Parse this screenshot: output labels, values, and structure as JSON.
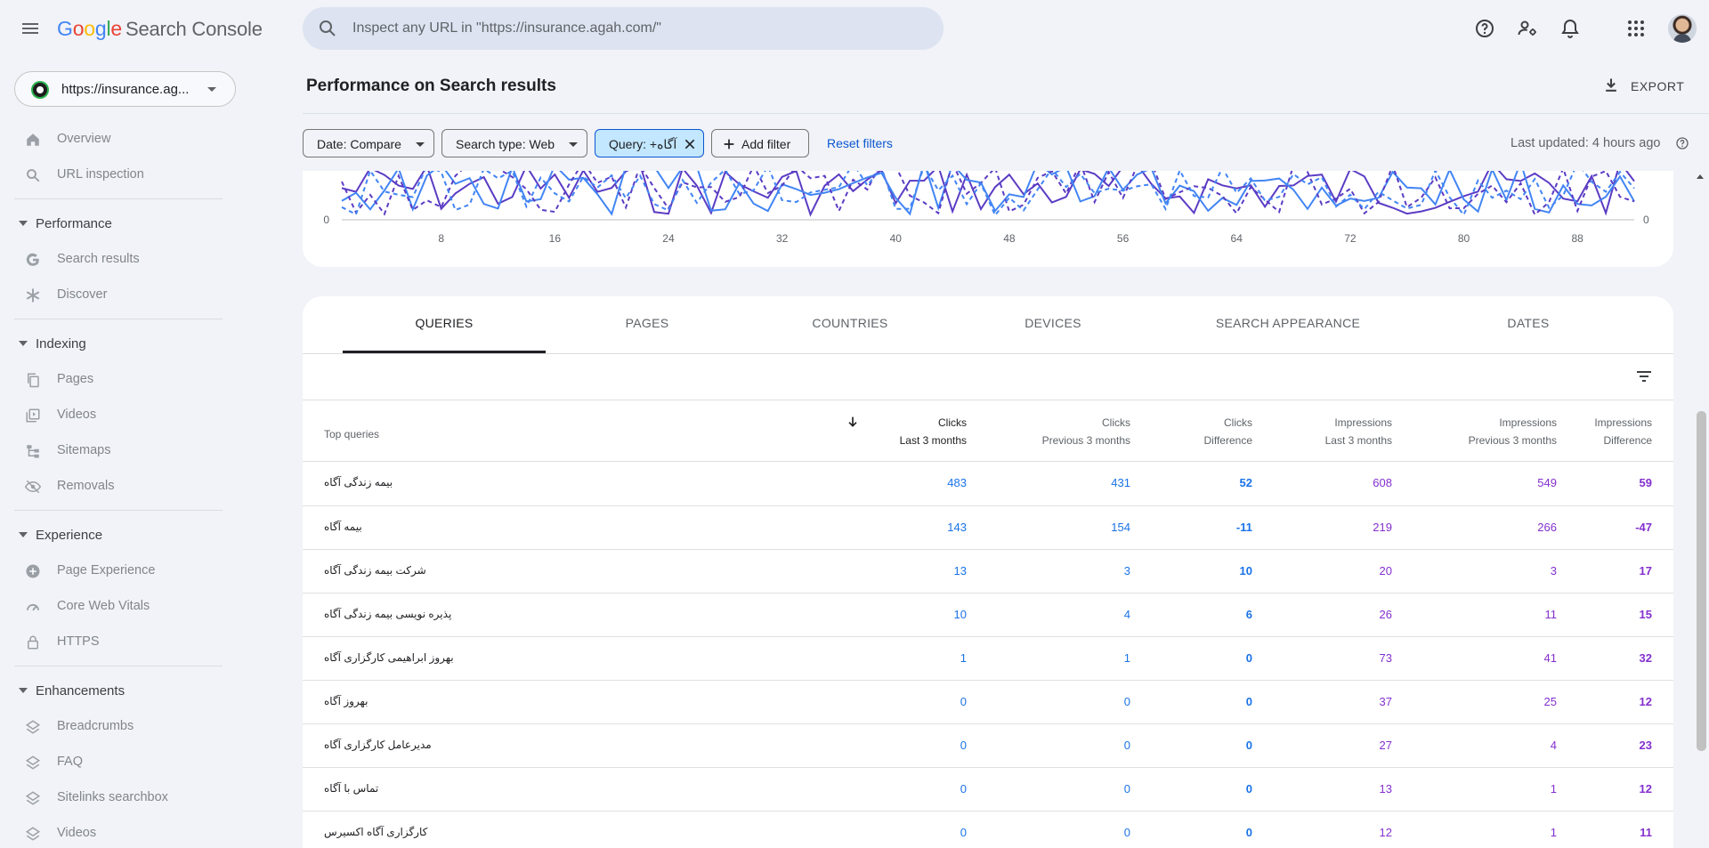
{
  "colors": {
    "clicks": "#1a73e8",
    "impressions": "#8430ce",
    "accent": "#0b57d0"
  },
  "topbar": {
    "logo": {
      "g1": "G",
      "g2": "o",
      "g3": "o",
      "g4": "g",
      "g5": "l",
      "g6": "e",
      "product": "Search Console"
    },
    "search_placeholder": "Inspect any URL in \"https://insurance.agah.com/\"",
    "icons": [
      "menu-icon",
      "search-icon",
      "help-icon",
      "manage-users-icon",
      "notifications-icon",
      "apps-icon",
      "avatar"
    ]
  },
  "sidebar": {
    "property": "https://insurance.ag...",
    "items": {
      "overview": "Overview",
      "url_inspection": "URL inspection",
      "performance": "Performance",
      "search_results": "Search results",
      "discover": "Discover",
      "indexing": "Indexing",
      "pages": "Pages",
      "videos": "Videos",
      "sitemaps": "Sitemaps",
      "removals": "Removals",
      "experience": "Experience",
      "page_experience": "Page Experience",
      "core_web_vitals": "Core Web Vitals",
      "https": "HTTPS",
      "enhancements": "Enhancements",
      "breadcrumbs": "Breadcrumbs",
      "faq": "FAQ",
      "sitelinks": "Sitelinks searchbox",
      "videos2": "Videos"
    }
  },
  "header": {
    "title": "Performance on Search results",
    "export": "EXPORT"
  },
  "filters": {
    "date": "Date: Compare",
    "search_type": "Search type: Web",
    "query": "Query: +آگاه",
    "add_filter": "Add filter",
    "reset": "Reset filters",
    "last_updated": "Last updated: 4 hours ago"
  },
  "chart_data": {
    "type": "line",
    "x_ticks": [
      "8",
      "16",
      "24",
      "32",
      "40",
      "48",
      "56",
      "64",
      "72",
      "80",
      "88"
    ],
    "y_left_tick": "0",
    "y_right_tick": "0",
    "series": [
      {
        "style": "solid",
        "color": "#5b3cc4"
      },
      {
        "style": "solid",
        "color": "#4285f4"
      },
      {
        "style": "dashed",
        "color": "#5b3cc4"
      },
      {
        "style": "dashed",
        "color": "#4285f4"
      }
    ]
  },
  "tabs": [
    "QUERIES",
    "PAGES",
    "COUNTRIES",
    "DEVICES",
    "SEARCH APPEARANCE",
    "DATES"
  ],
  "table": {
    "first_header": "Top queries",
    "headers": [
      {
        "l1": "Clicks",
        "l2": "Last 3 months"
      },
      {
        "l1": "Clicks",
        "l2": "Previous 3 months"
      },
      {
        "l1": "Clicks",
        "l2": "Difference"
      },
      {
        "l1": "Impressions",
        "l2": "Last 3 months"
      },
      {
        "l1": "Impressions",
        "l2": "Previous 3 months"
      },
      {
        "l1": "Impressions",
        "l2": "Difference"
      }
    ],
    "rows": [
      {
        "query": "بیمه زندگی آگاه",
        "clicks": "483",
        "clicks_prev": "431",
        "clicks_diff": "52",
        "imp": "608",
        "imp_prev": "549",
        "imp_diff": "59"
      },
      {
        "query": "بیمه آگاه",
        "clicks": "143",
        "clicks_prev": "154",
        "clicks_diff": "-11",
        "imp": "219",
        "imp_prev": "266",
        "imp_diff": "-47"
      },
      {
        "query": "شرکت بیمه زندگی آگاه",
        "clicks": "13",
        "clicks_prev": "3",
        "clicks_diff": "10",
        "imp": "20",
        "imp_prev": "3",
        "imp_diff": "17"
      },
      {
        "query": "پذیره نویسی بیمه زندگی آگاه",
        "clicks": "10",
        "clicks_prev": "4",
        "clicks_diff": "6",
        "imp": "26",
        "imp_prev": "11",
        "imp_diff": "15"
      },
      {
        "query": "بهروز ابراهیمی کارگزاری آگاه",
        "clicks": "1",
        "clicks_prev": "1",
        "clicks_diff": "0",
        "imp": "73",
        "imp_prev": "41",
        "imp_diff": "32"
      },
      {
        "query": "بهروز آگاه",
        "clicks": "0",
        "clicks_prev": "0",
        "clicks_diff": "0",
        "imp": "37",
        "imp_prev": "25",
        "imp_diff": "12"
      },
      {
        "query": "مدیرعامل کارگزاری آگاه",
        "clicks": "0",
        "clicks_prev": "0",
        "clicks_diff": "0",
        "imp": "27",
        "imp_prev": "4",
        "imp_diff": "23"
      },
      {
        "query": "تماس با آگاه",
        "clicks": "0",
        "clicks_prev": "0",
        "clicks_diff": "0",
        "imp": "13",
        "imp_prev": "1",
        "imp_diff": "12"
      },
      {
        "query": "کارگزاری آگاه اکسیرس",
        "clicks": "0",
        "clicks_prev": "0",
        "clicks_diff": "0",
        "imp": "12",
        "imp_prev": "1",
        "imp_diff": "11"
      }
    ]
  }
}
